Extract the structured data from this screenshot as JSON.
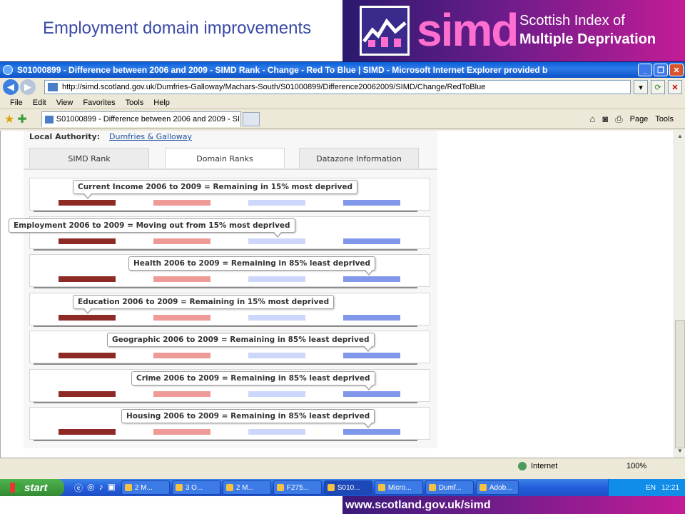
{
  "slide": {
    "title": "Employment domain improvements",
    "banner_word": "simd",
    "banner_line1": "Scottish Index of",
    "banner_line2": "Multiple Deprivation",
    "footer_url": "www.scotland.gov.uk/simd"
  },
  "browser": {
    "title": "S01000899 - Difference between 2006 and 2009 - SIMD Rank - Change - Red To Blue | SIMD - Microsoft Internet Explorer provided b",
    "address": "http://simd.scotland.gov.uk/Dumfries-Galloway/Machars-South/S01000899/Difference20062009/SIMD/Change/RedToBlue",
    "menu": [
      "File",
      "Edit",
      "View",
      "Favorites",
      "Tools",
      "Help"
    ],
    "tab_title": "S01000899 - Difference between 2006 and 2009 - SI...",
    "tools": {
      "page": "Page",
      "tools": "Tools"
    },
    "status": {
      "zone": "Internet",
      "zoom": "100%"
    }
  },
  "page": {
    "local_authority_label": "Local Authority:",
    "local_authority_value": "Dumfries & Galloway",
    "tabs": [
      "SIMD Rank",
      "Domain Ranks",
      "Datazone Information"
    ],
    "active_tab": "Domain Ranks",
    "domains": [
      {
        "label": "Current Income 2006 to 2009 = Remaining in 15% most deprived",
        "band": 1
      },
      {
        "label": "Employment 2006 to 2009 = Moving out from 15% most deprived",
        "band": 3
      },
      {
        "label": "Health 2006 to 2009 = Remaining in 85% least deprived",
        "band": 4
      },
      {
        "label": "Education 2006 to 2009 = Remaining in 15% most deprived",
        "band": 1
      },
      {
        "label": "Geographic 2006 to 2009 = Remaining in 85% least deprived",
        "band": 4
      },
      {
        "label": "Crime 2006 to 2009 = Remaining in 85% least deprived",
        "band": 4
      },
      {
        "label": "Housing 2006 to 2009 = Remaining in 85% least deprived",
        "band": 4
      }
    ],
    "band_colors": [
      "#8e2a26",
      "#ee9a96",
      "#cdd7fb",
      "#8197ea"
    ]
  },
  "taskbar": {
    "start": "start",
    "tasks": [
      "2 M...",
      "3 O...",
      "2 M...",
      "F275...",
      "S010...",
      "Micro...",
      "Dumf...",
      "Adob..."
    ],
    "active_task": "S010...",
    "lang": "EN",
    "clock": "12:21"
  }
}
